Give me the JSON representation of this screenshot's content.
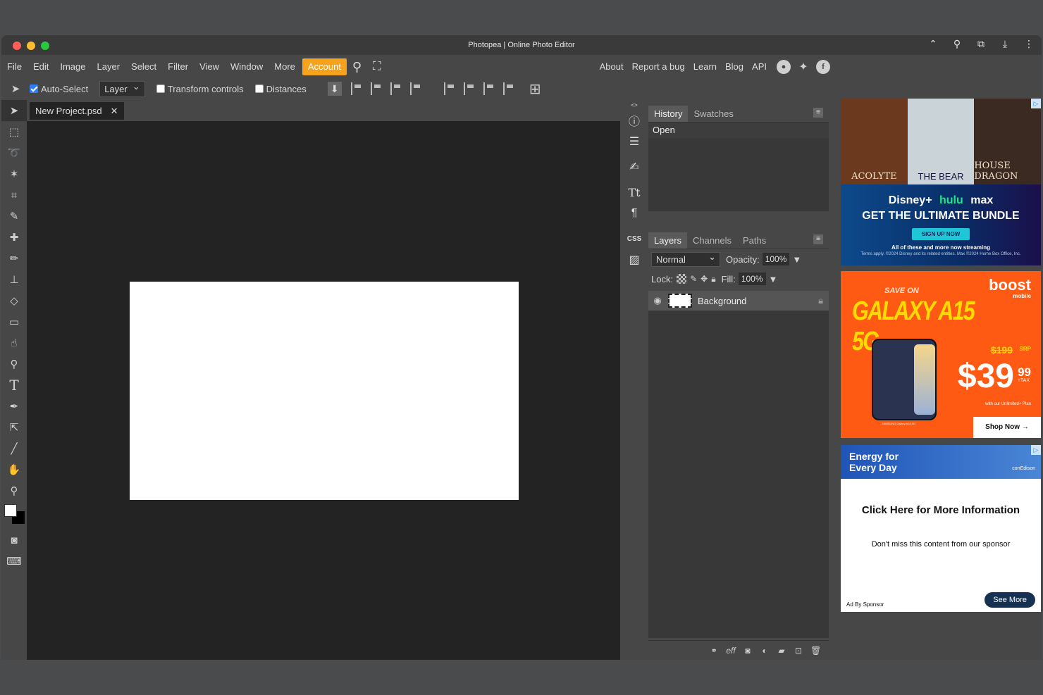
{
  "window": {
    "title": "Photopea | Online Photo Editor"
  },
  "menu": {
    "items": [
      "File",
      "Edit",
      "Image",
      "Layer",
      "Select",
      "Filter",
      "View",
      "Window",
      "More"
    ],
    "account": "Account",
    "right_items": [
      "About",
      "Report a bug",
      "Learn",
      "Blog",
      "API"
    ]
  },
  "options": {
    "auto_select_label": "Auto-Select",
    "auto_select_checked": true,
    "layer_select_value": "Layer",
    "transform_controls_label": "Transform controls",
    "distances_label": "Distances"
  },
  "document": {
    "tab_label": "New Project.psd",
    "close_glyph": "✕"
  },
  "history_panel": {
    "tabs": [
      "History",
      "Swatches"
    ],
    "entries": [
      "Open"
    ]
  },
  "layers_panel": {
    "tabs": [
      "Layers",
      "Channels",
      "Paths"
    ],
    "blend_mode": "Normal",
    "opacity_label": "Opacity:",
    "opacity_value": "100%",
    "lock_label": "Lock:",
    "fill_label": "Fill:",
    "fill_value": "100%",
    "layers": [
      {
        "name": "Background",
        "visible": true,
        "locked": true
      }
    ]
  },
  "ads": {
    "ad1": {
      "posters": [
        "ACOLYTE",
        "THE BEAR",
        "HOUSE DRAGON"
      ],
      "brands": [
        "Disney+",
        "hulu",
        "max"
      ],
      "headline": "GET THE ULTIMATE BUNDLE",
      "cta": "SIGN UP NOW",
      "tagline": "All of these and more now streaming",
      "terms": "Terms apply. ©2024 Disney and its related entities. Max ©2024 Home Box Office, Inc."
    },
    "ad2": {
      "save_on": "SAVE ON",
      "product": "GALAXY A15 5G",
      "brand": "boost",
      "brand_sub": "mobile",
      "old_price": "$199",
      "srp": "SRP",
      "price": "$39",
      "cents": "99",
      "tax": "+TAX",
      "plan": "with our Unlimited+ Plan",
      "phone_caption": "SAMSUNG Galaxy A15 5G",
      "cta": "Shop Now →"
    },
    "ad3": {
      "header": "Energy for Every Day",
      "brand": "conEdison",
      "headline": "Click Here for More Information",
      "body": "Don't miss this content from our sponsor",
      "ad_by": "Ad By Sponsor",
      "cta": "See More"
    }
  },
  "colors": {
    "accent": "#f5a21d",
    "workspace_bg": "#232323",
    "panel_bg": "#474747",
    "canvas_bg": "#ffffff"
  }
}
